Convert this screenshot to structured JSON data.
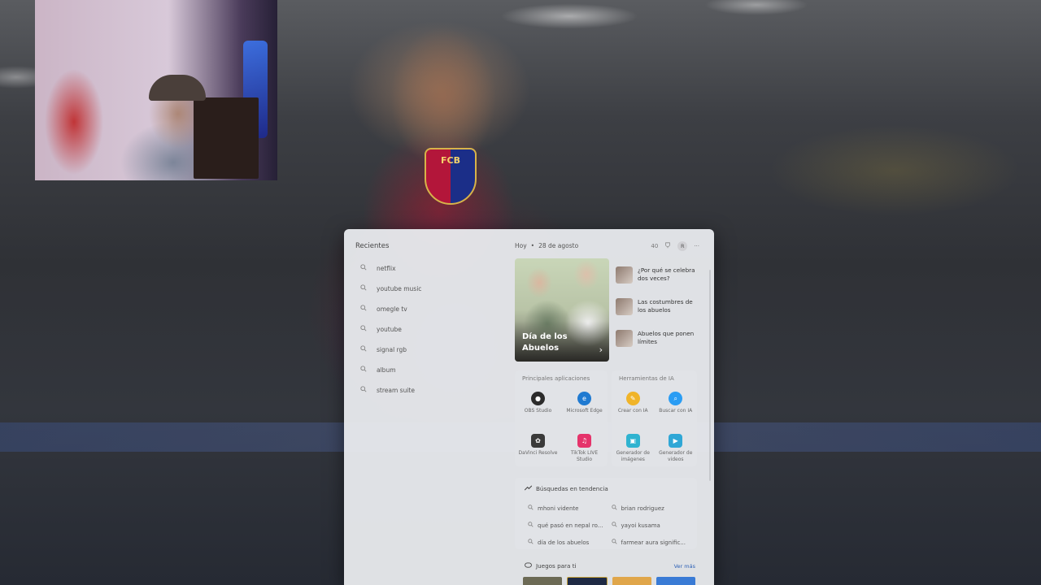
{
  "search_panel": {
    "recent_heading": "Recientes",
    "recent_searches": [
      "netflix",
      "youtube music",
      "omegle tv",
      "youtube",
      "signal rgb",
      "album",
      "stream suite"
    ],
    "date_label": "Hoy",
    "date_separator": "•",
    "date_value": "28 de agosto",
    "top_icons": {
      "badge_text": "40",
      "avatar_initial": "R",
      "more_text": "···"
    },
    "hero": {
      "title": "Día de los Abuelos",
      "arrow": "›"
    },
    "news": [
      "¿Por qué se celebra dos veces?",
      "Las costumbres de los abuelos",
      "Abuelos que ponen límites"
    ],
    "top_apps": {
      "title": "Principales aplicaciones",
      "items": [
        {
          "label": "OBS Studio",
          "icon": "obs-icon",
          "color": "#2b2b2b"
        },
        {
          "label": "Microsoft Edge",
          "icon": "edge-icon",
          "color": "#1f7ad1"
        },
        {
          "label": "DaVinci Resolve",
          "icon": "davinci-icon",
          "color": "#3a3a3a"
        },
        {
          "label": "TikTok LIVE Studio",
          "icon": "tiktok-icon",
          "color": "#e5336b"
        }
      ]
    },
    "ai_tools": {
      "title": "Herramientas de IA",
      "items": [
        {
          "label": "Crear con IA",
          "icon": "create-ai-icon",
          "color": "#f0b429"
        },
        {
          "label": "Buscar con IA",
          "icon": "search-ai-icon",
          "color": "#2a9df4"
        },
        {
          "label": "Generador de imágenes",
          "icon": "image-generator-icon",
          "color": "#2fb3d0"
        },
        {
          "label": "Generador de videos",
          "icon": "video-generator-icon",
          "color": "#2fa7d6"
        }
      ]
    },
    "trending": {
      "title": "Búsquedas en tendencia",
      "items": [
        "mhoni vidente",
        "brian rodriguez",
        "qué pasó en nepal ro...",
        "yayoi kusama",
        "día de los abuelos",
        "farmear aura signific..."
      ]
    },
    "games": {
      "title": "Juegos para ti",
      "see_more": "Ver más"
    }
  },
  "background": {
    "crest_text": "FCB"
  }
}
